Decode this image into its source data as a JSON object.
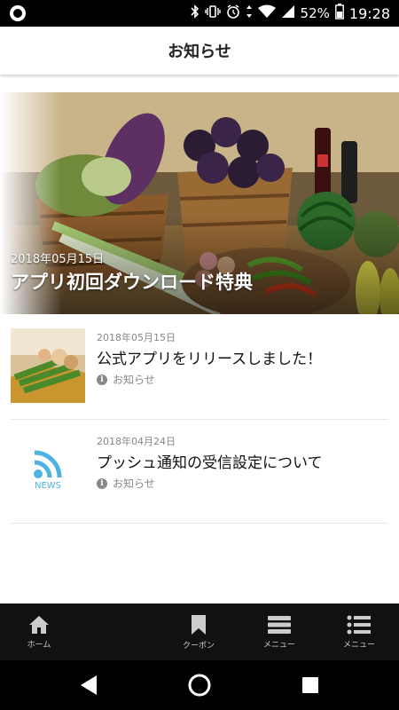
{
  "status_bar": {
    "battery_percent": "52%",
    "time": "19:28"
  },
  "app_bar": {
    "title": "お知らせ"
  },
  "hero": {
    "date": "2018年05月15日",
    "headline": "アプリ初回ダウンロード特典"
  },
  "news_items": [
    {
      "date": "2018年05月15日",
      "title": "公式アプリをリリースしました！",
      "category": "お知らせ",
      "thumbnail": "food-photo"
    },
    {
      "date": "2018年04月24日",
      "title": "プッシュ通知の受信設定について",
      "category": "お知らせ",
      "thumbnail": "news-rss-icon",
      "thumbnail_label": "NEWS"
    }
  ],
  "tabs": [
    {
      "label": "ホーム",
      "icon": "home-icon"
    },
    {
      "label": "クーポン",
      "icon": "bookmark-icon"
    },
    {
      "label": "メニュー",
      "icon": "menu-card-icon"
    },
    {
      "label": "メニュー",
      "icon": "list-icon"
    }
  ],
  "colors": {
    "accent_news": "#4fb2e0",
    "tabbar_bg": "#111111"
  }
}
